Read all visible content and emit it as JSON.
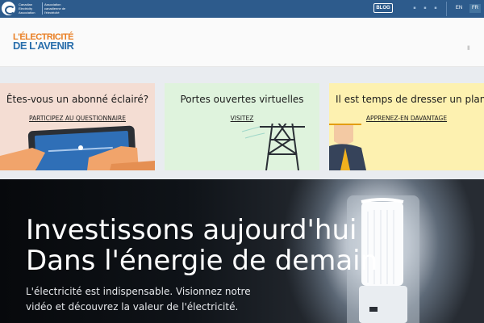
{
  "topbar": {
    "org_en": "Canadian Electricity Association",
    "org_fr": "Association canadienne de l'électricité",
    "blog_label": "BLOG",
    "social_icons": [
      "facebook-icon",
      "twitter-icon",
      "youtube-icon"
    ],
    "lang_en": "EN",
    "lang_fr": "FR",
    "lang_active": "FR",
    "bar_color": "#2d5b8c"
  },
  "header": {
    "brand_line1": "L'ÉLECTRICITÉ",
    "brand_line2": "DE L'AVENIR",
    "brand_colors": [
      "#e97f24",
      "#2a6fac"
    ]
  },
  "cards": [
    {
      "title": "Êtes-vous un abonné éclairé?",
      "link": "PARTICIPEZ AU QUESTIONNAIRE",
      "bg": "#f4ddd3"
    },
    {
      "title": "Portes ouvertes virtuelles",
      "link": "VISITEZ",
      "bg": "#dff3dd"
    },
    {
      "title": "Il est temps de dresser un plan",
      "link": "APPRENEZ-EN DAVANTAGE",
      "bg": "#fdf1b0"
    }
  ],
  "hero": {
    "title_line1": "Investissons aujourd'hui",
    "title_line2": "Dans l'énergie de demain",
    "subtitle": "L'électricité est indispensable. Visionnez notre vidéo et découvrez la valeur de l'électricité."
  }
}
